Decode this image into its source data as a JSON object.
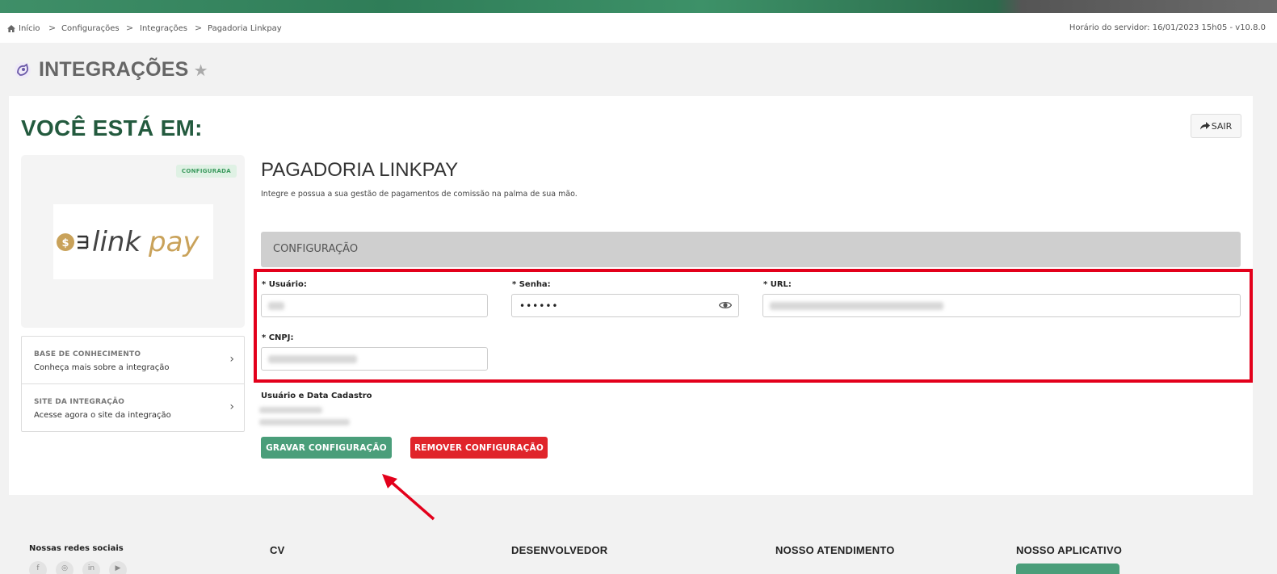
{
  "breadcrumb": {
    "items": [
      "Início",
      "Configurações",
      "Integrações",
      "Pagadoria Linkpay"
    ],
    "separator": ">"
  },
  "server_time": "Horário do servidor: 16/01/2023 15h05 - v10.8.0",
  "page_title": "INTEGRAÇÕES",
  "you_are_in": "VOCÊ ESTÁ EM:",
  "exit_label": "SAIR",
  "integration": {
    "status_badge": "CONFIGURADA",
    "logo_text_dark": "link",
    "logo_text_gold": "pay",
    "logo_coin_symbol": "$",
    "title": "PAGADORIA LINKPAY",
    "description": "Integre e possua a sua gestão de pagamentos de comissão na palma de sua mão."
  },
  "side_links": [
    {
      "title": "BASE DE CONHECIMENTO",
      "subtitle": "Conheça mais sobre a integração"
    },
    {
      "title": "SITE DA INTEGRAÇÃO",
      "subtitle": "Acesse agora o site da integração"
    }
  ],
  "config": {
    "section_title": "CONFIGURAÇÃO",
    "fields": {
      "usuario_label": "* Usuário:",
      "senha_label": "* Senha:",
      "senha_value": "••••••",
      "url_label": "* URL:",
      "cnpj_label": "* CNPJ:"
    },
    "meta_label": "Usuário e Data Cadastro",
    "save_button": "GRAVAR CONFIGURAÇÃO",
    "remove_button": "REMOVER CONFIGURAÇÃO"
  },
  "footer": {
    "social_title": "Nossas redes sociais",
    "columns": [
      "CV",
      "DESENVOLVEDOR",
      "NOSSO ATENDIMENTO",
      "NOSSO APLICATIVO"
    ],
    "social_icons": [
      "facebook-icon",
      "instagram-icon",
      "linkedin-icon",
      "youtube-icon"
    ]
  },
  "colors": {
    "brand_green": "#235a3e",
    "button_green": "#4a9e7a",
    "button_red": "#e0242a",
    "highlight_red": "#e3001b",
    "logo_gold": "#c9a25a"
  }
}
